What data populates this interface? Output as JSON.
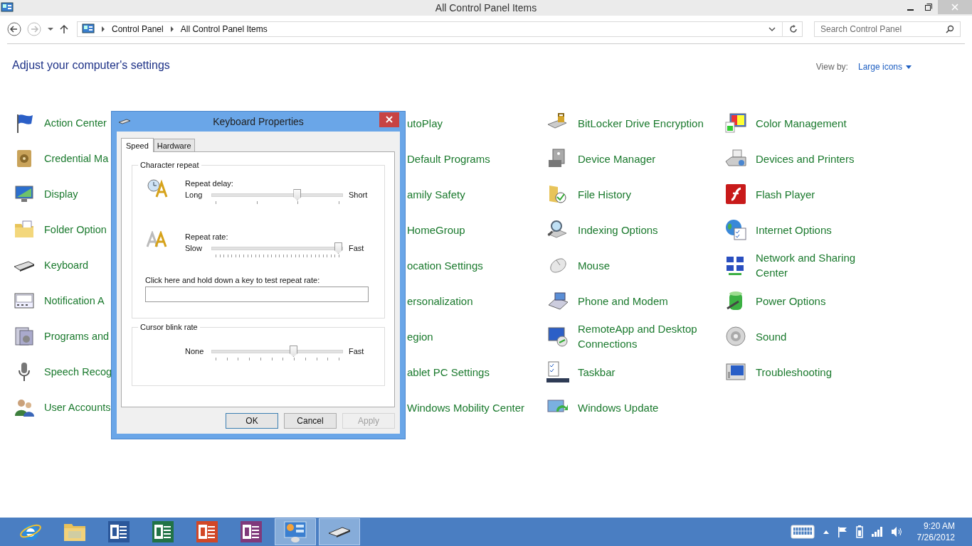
{
  "window": {
    "title": "All Control Panel Items"
  },
  "address_bar": {
    "breadcrumb": [
      "Control Panel",
      "All Control Panel Items"
    ]
  },
  "search": {
    "placeholder": "Search Control Panel"
  },
  "heading": "Adjust your computer's settings",
  "view_by": {
    "label": "View by:",
    "value": "Large icons"
  },
  "columns": [
    {
      "kind": "full",
      "items": [
        "Action Center",
        "Credential Ma",
        "Display",
        "Folder Option",
        "Keyboard",
        "Notification A",
        "Programs and",
        "Speech Recog",
        "User Accounts"
      ]
    },
    {
      "kind": "hidden_icons",
      "items": [
        "utoPlay",
        "Default Programs",
        "amily Safety",
        "HomeGroup",
        "ocation Settings",
        "ersonalization",
        "egion",
        "ablet PC Settings",
        "Windows Mobility Center"
      ]
    },
    {
      "kind": "full",
      "items": [
        "BitLocker Drive Encryption",
        "Device Manager",
        "File History",
        "Indexing Options",
        "Mouse",
        "Phone and Modem",
        "RemoteApp and Desktop Connections",
        "Taskbar",
        "Windows Update"
      ]
    },
    {
      "kind": "full",
      "items": [
        "Color Management",
        "Devices and Printers",
        "Flash Player",
        "Internet Options",
        "Network and Sharing Center",
        "Power Options",
        "Sound",
        "Troubleshooting"
      ]
    }
  ],
  "dialog": {
    "title": "Keyboard Properties",
    "tabs": [
      {
        "label": "Speed",
        "selected": true
      },
      {
        "label": "Hardware",
        "selected": false
      }
    ],
    "groups": [
      {
        "title": "Character repeat",
        "sliders": [
          {
            "kind": "delay",
            "label": "Repeat delay:",
            "min_label": "Long",
            "max_label": "Short",
            "level": 0.667
          },
          {
            "kind": "rate",
            "label": "Repeat rate:",
            "min_label": "Slow",
            "max_label": "Fast",
            "level": 1
          }
        ],
        "test_field": {
          "label": "Click here and hold down a key to test repeat rate:"
        }
      },
      {
        "title": "Cursor blink rate",
        "sliders": [
          {
            "kind": "blink",
            "min_label": "None",
            "max_label": "Fast",
            "level": 0.636
          }
        ]
      }
    ],
    "buttons": [
      {
        "label": "OK",
        "default": true,
        "disabled": false
      },
      {
        "label": "Cancel",
        "default": false,
        "disabled": false
      },
      {
        "label": "Apply",
        "default": false,
        "disabled": true
      }
    ]
  },
  "taskbar": {
    "apps": [
      {
        "kind": "browser",
        "active": false
      },
      {
        "kind": "explorer",
        "active": false
      },
      {
        "kind": "word",
        "active": false
      },
      {
        "kind": "excel",
        "active": false
      },
      {
        "kind": "powerpoint",
        "active": false
      },
      {
        "kind": "onenote",
        "active": false
      },
      {
        "kind": "control-panel",
        "active": true
      },
      {
        "kind": "keyboard",
        "active": true
      }
    ],
    "time": "9:20 AM",
    "date": "7/26/2012"
  }
}
